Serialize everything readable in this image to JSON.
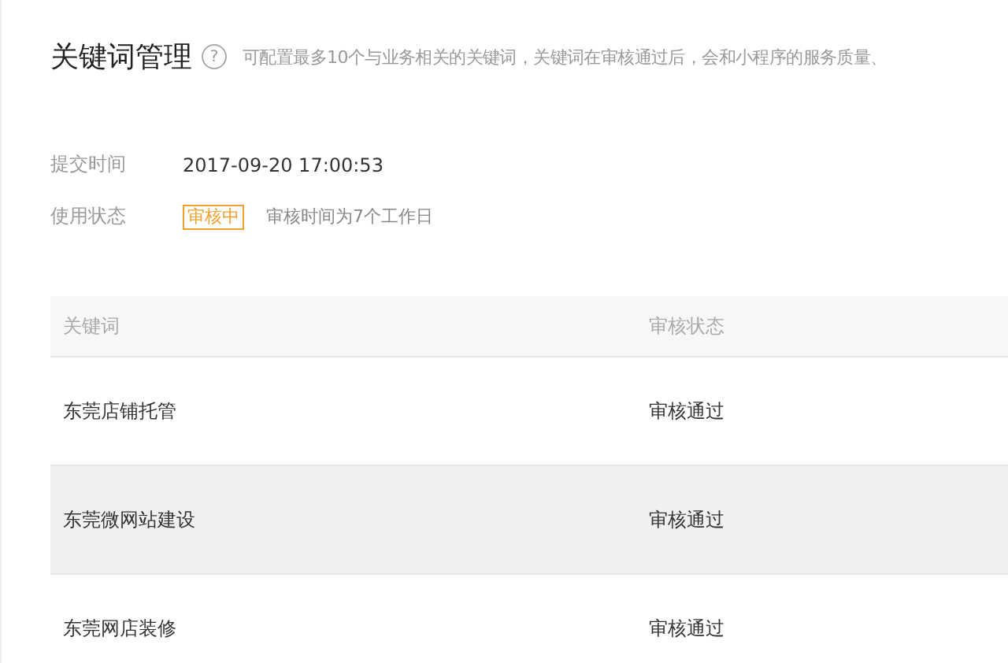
{
  "header": {
    "title": "关键词管理",
    "help_icon": "?",
    "description": "可配置最多10个与业务相关的关键词，关键词在审核通过后，会和小程序的服务质量、"
  },
  "info": [
    {
      "label": "提交时间",
      "kind": "text",
      "value": "2017-09-20 17:00:53"
    },
    {
      "label": "使用状态",
      "kind": "status",
      "badge": "审核中",
      "note": "审核时间为7个工作日"
    }
  ],
  "table": {
    "columns": [
      "关键词",
      "审核状态"
    ],
    "rows": [
      {
        "keyword": "东莞店铺托管",
        "status": "审核通过",
        "selected": false
      },
      {
        "keyword": "东莞微网站建设",
        "status": "审核通过",
        "selected": true
      },
      {
        "keyword": "东莞网店装修",
        "status": "审核通过",
        "selected": false
      }
    ]
  }
}
